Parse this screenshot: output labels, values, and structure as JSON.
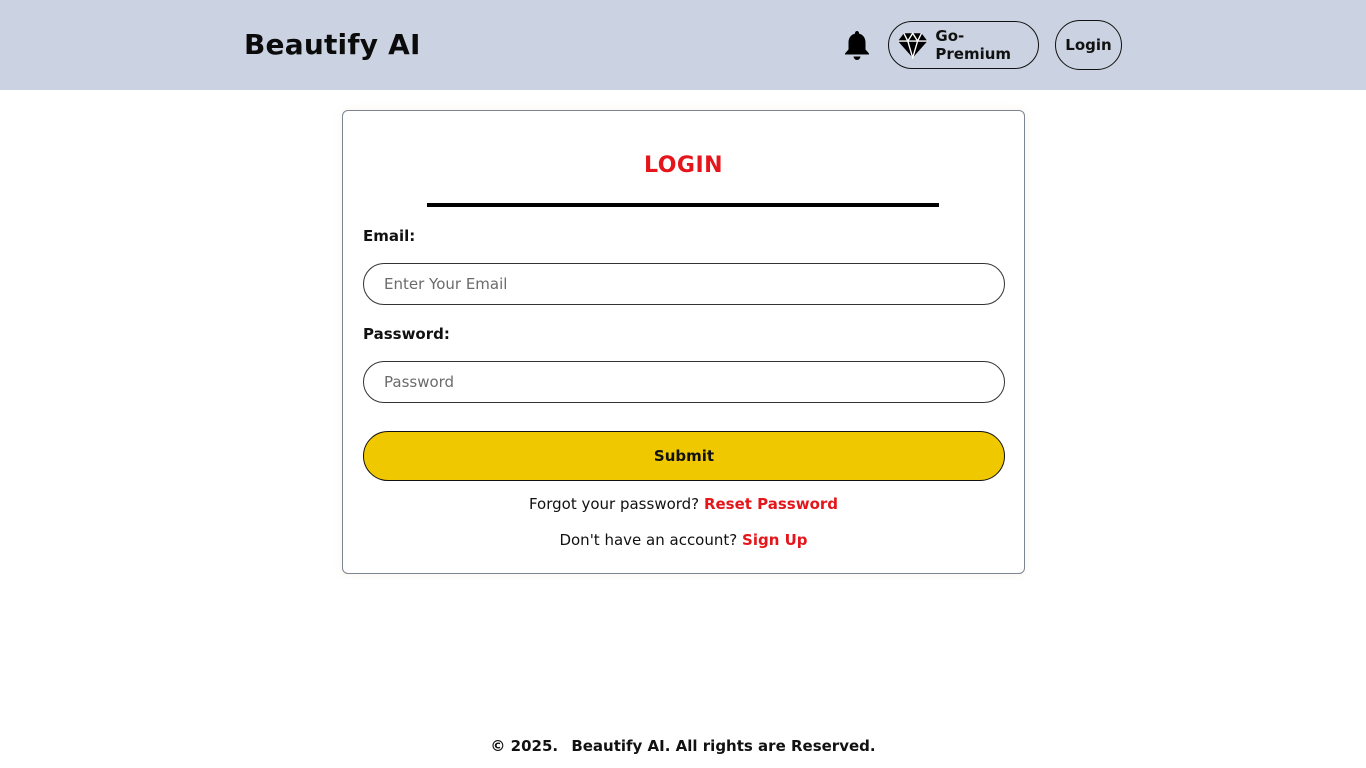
{
  "header": {
    "brand": "Beautify AI",
    "notification_icon": "bell-icon",
    "premium_icon": "diamond-icon",
    "premium_label": "Go-Premium",
    "login_label": "Login"
  },
  "login_form": {
    "title": "LOGIN",
    "email_label": "Email:",
    "email_placeholder": "Enter Your Email",
    "email_value": "",
    "password_label": "Password:",
    "password_placeholder": "Password",
    "password_value": "",
    "submit_label": "Submit",
    "forgot_text": "Forgot your password?",
    "reset_link": "Reset Password",
    "signup_text": "Don't have an account?",
    "signup_link": "Sign Up"
  },
  "footer": {
    "year": "© 2025.",
    "rights": "Beautify AI. All rights are Reserved."
  },
  "colors": {
    "header_bg": "#cbd3e2",
    "accent_red": "#e4161b",
    "submit_yellow": "#f0c800"
  }
}
